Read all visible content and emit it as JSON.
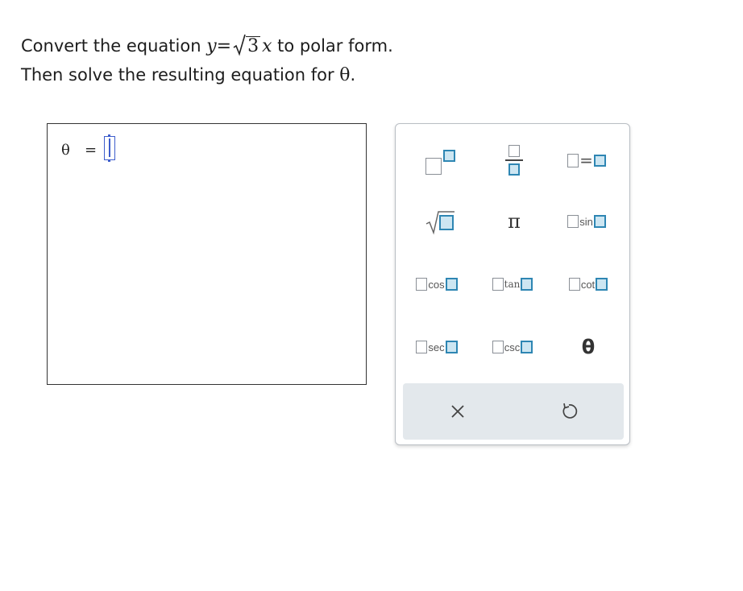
{
  "prompt": {
    "line1_before": "Convert the equation ",
    "var_y": "y",
    "equals": "=",
    "radicand": "3",
    "var_x": "x",
    "line1_after": " to polar form.",
    "line2_before": "Then solve the resulting equation for ",
    "theta": "θ",
    "line2_after": "."
  },
  "answer": {
    "lhs": "θ",
    "equals": "=",
    "value": ""
  },
  "keypad": {
    "pi": "π",
    "theta": "θ",
    "sin": "sin",
    "cos": "cos",
    "tan": "tan",
    "cot": "cot",
    "sec": "sec",
    "csc": "csc",
    "equals": "=",
    "clear_icon": "close-icon",
    "undo_icon": "undo-icon"
  },
  "colors": {
    "accent": "#2e86b3",
    "cursor": "#3d5dcc",
    "action_bar": "#e3e8ec"
  }
}
